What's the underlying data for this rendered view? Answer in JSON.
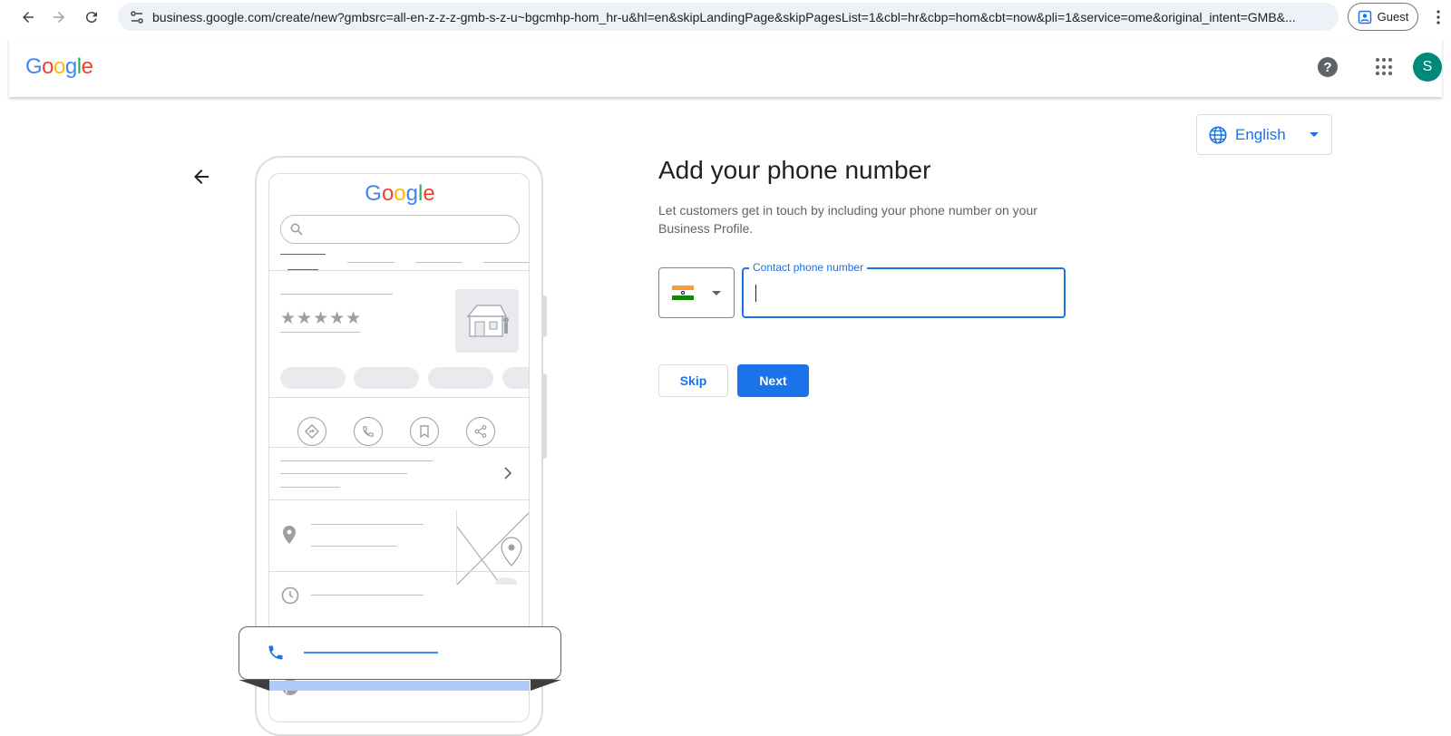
{
  "browser": {
    "url": "business.google.com/create/new?gmbsrc=all-en-z-z-z-gmb-s-z-u~bgcmhp-hom_hr-u&hl=en&skipLandingPage&skipPagesList=1&cbl=hr&cbp=hom&cbt=now&pli=1&service=ome&original_intent=GMB&...",
    "profile_label": "Guest"
  },
  "header": {
    "logo_letters": [
      "G",
      "o",
      "o",
      "g",
      "l",
      "e"
    ],
    "logo_colors": [
      "#4285f4",
      "#ea4335",
      "#fbbc05",
      "#4285f4",
      "#34a853",
      "#ea4335"
    ],
    "help_label": "?",
    "avatar_initial": "S"
  },
  "language": {
    "selected": "English"
  },
  "form": {
    "title": "Add your phone number",
    "description": "Let customers get in touch by including your phone number on your Business Profile.",
    "country_flag": "india-flag-icon",
    "phone_label": "Contact phone number",
    "phone_value": "",
    "skip_label": "Skip",
    "next_label": "Next"
  },
  "illustration": {
    "logo_text": "Google",
    "stars": "★★★★★"
  },
  "colors": {
    "accent": "#1a73e8",
    "avatar_bg": "#00897b"
  }
}
